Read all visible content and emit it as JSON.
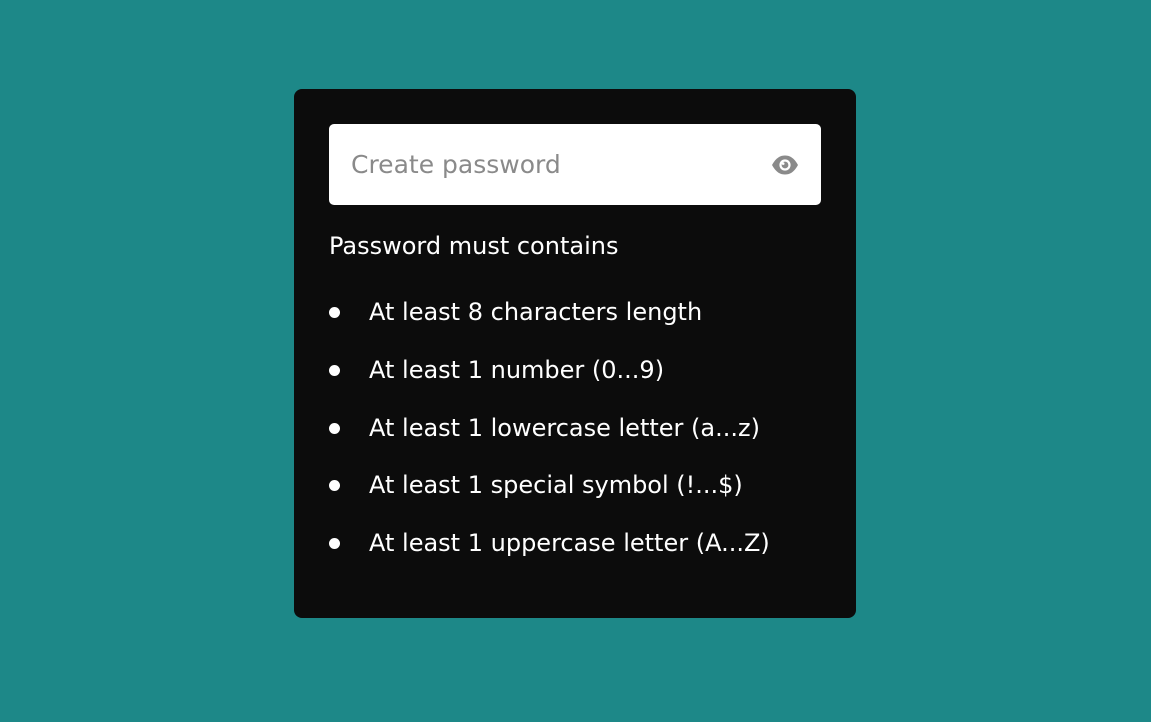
{
  "password_field": {
    "value": "",
    "placeholder": "Create password",
    "toggle_icon": "eye-icon"
  },
  "requirements": {
    "title": "Password must contains",
    "items": [
      {
        "label": "At least 8 characters length"
      },
      {
        "label": "At least 1 number (0...9)"
      },
      {
        "label": "At least 1 lowercase letter (a...z)"
      },
      {
        "label": "At least 1 special symbol (!...$)"
      },
      {
        "label": "At least 1 uppercase letter (A...Z)"
      }
    ]
  },
  "colors": {
    "background": "#1d8888",
    "card": "#0c0c0c",
    "input_bg": "#ffffff",
    "text": "#ffffff",
    "placeholder": "#8a8a8a",
    "icon": "#8a8a8a"
  }
}
